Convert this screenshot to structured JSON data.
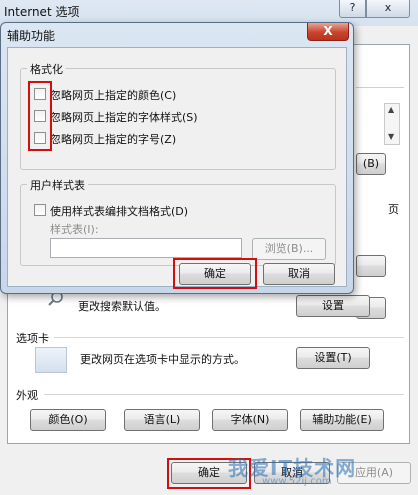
{
  "background_window": {
    "title": "Internet 选项",
    "help_label": "?",
    "close_label": "x",
    "fragments": {
      "scroll_right": "(B)",
      "right_edge_text": "页",
      "row_search_text": "更改搜索默认值。",
      "row_search_button": "设置"
    },
    "tabs_section": {
      "heading": "选项卡",
      "description": "更改网页在选项卡中显示的方式。",
      "settings_button": "设置(T)"
    },
    "appearance_section": {
      "heading": "外观",
      "buttons": [
        "颜色(O)",
        "语言(L)",
        "字体(N)",
        "辅助功能(E)"
      ]
    },
    "footer": {
      "ok": "确定",
      "cancel": "取消",
      "apply": "应用(A)"
    }
  },
  "dialog": {
    "title": "辅助功能",
    "close_label": "X",
    "formatting": {
      "legend": "格式化",
      "items": [
        {
          "label": "忽略网页上指定的颜色(C)",
          "checked": false
        },
        {
          "label": "忽略网页上指定的字体样式(S)",
          "checked": false
        },
        {
          "label": "忽略网页上指定的字号(Z)",
          "checked": false
        }
      ]
    },
    "user_stylesheet": {
      "legend": "用户样式表",
      "checkbox_label": "使用样式表编排文档格式(D)",
      "checked": false,
      "field_label": "样式表(I):",
      "field_value": "",
      "browse_button": "浏览(B)..."
    },
    "ok_button": "确定",
    "cancel_button": "取消"
  },
  "watermark": {
    "text": "我爱IT技术网",
    "sub": "www.52ij.com"
  },
  "colors": {
    "highlight": "#d60d0d",
    "dialog_frame": "#c7d7ea"
  }
}
